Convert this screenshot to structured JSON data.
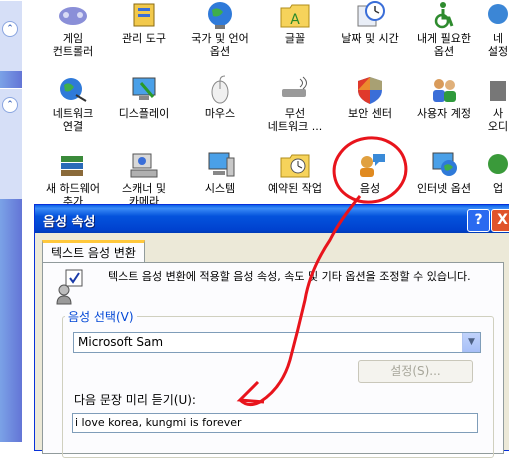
{
  "control_panel": {
    "row1": [
      {
        "label": "게임\n컨트롤러",
        "icon": "gamepad-icon"
      },
      {
        "label": "관리 도구",
        "icon": "admin-tools-icon"
      },
      {
        "label": "국가 및 언어\n옵션",
        "icon": "globe-icon"
      },
      {
        "label": "글꼴",
        "icon": "fonts-folder-icon"
      },
      {
        "label": "날짜 및 시간",
        "icon": "clock-icon"
      },
      {
        "label": "내게 필요한\n옵션",
        "icon": "accessibility-icon"
      },
      {
        "label": "네\n설정",
        "icon": "network-setup-icon"
      }
    ],
    "row2": [
      {
        "label": "네트워크\n연결",
        "icon": "network-globe-icon"
      },
      {
        "label": "디스플레이",
        "icon": "display-icon"
      },
      {
        "label": "마우스",
        "icon": "mouse-icon"
      },
      {
        "label": "무선\n네트워크 ...",
        "icon": "wireless-icon"
      },
      {
        "label": "보안 센터",
        "icon": "shield-icon"
      },
      {
        "label": "사용자 계정",
        "icon": "users-icon"
      },
      {
        "label": "사\n오디",
        "icon": "audio-icon"
      }
    ],
    "row3": [
      {
        "label": "새 하드웨어\n추가",
        "icon": "add-hardware-icon"
      },
      {
        "label": "스캐너 및\n카메라",
        "icon": "scanner-camera-icon"
      },
      {
        "label": "시스템",
        "icon": "system-icon"
      },
      {
        "label": "예약된 작업",
        "icon": "scheduled-tasks-icon"
      },
      {
        "label": "음성",
        "icon": "speech-icon"
      },
      {
        "label": "인터넷 옵션",
        "icon": "internet-options-icon"
      },
      {
        "label": "업",
        "icon": "update-icon"
      }
    ]
  },
  "dialog": {
    "title": "음성 속성",
    "help_btn": "?",
    "close_btn": "X",
    "tab_label": "텍스트 음성 변환",
    "description": "텍스트 음성 변환에 적용할 음성 속성, 속도 및 기타 옵션을 조정할 수 있습니다.",
    "voice_group_label": "음성 선택(V)",
    "voice_selected": "Microsoft Sam",
    "settings_button": "설정(S)...",
    "preview_label": "다음 문장 미리 듣기(U):",
    "preview_text": "i love korea, kungmi is forever"
  },
  "colors": {
    "annotation_red": "#e8141c",
    "titlebar_blue": "#0453dc",
    "dialog_bg": "#ece9d8"
  }
}
